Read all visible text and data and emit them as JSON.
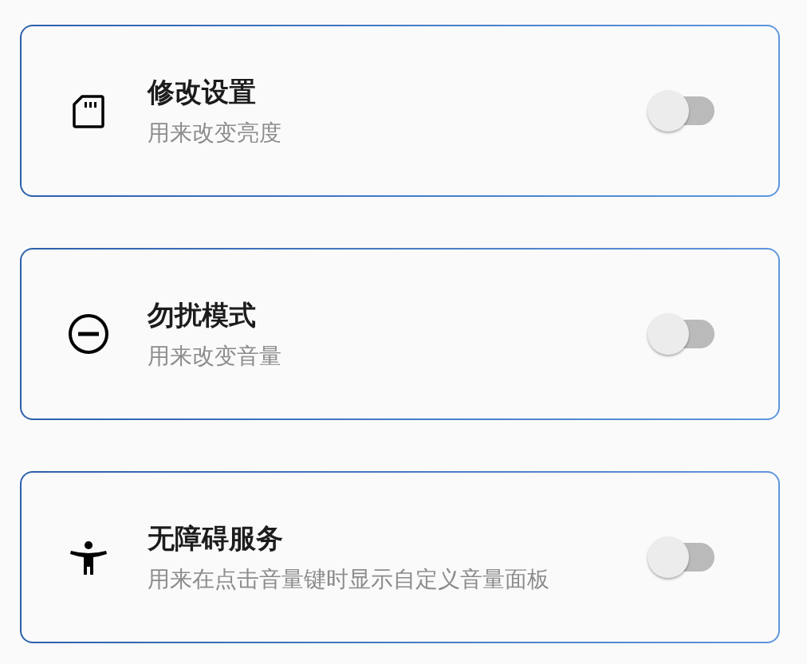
{
  "settings": [
    {
      "kind": "sd-card",
      "title": "修改设置",
      "subtitle": "用来改变亮度",
      "on": false
    },
    {
      "kind": "do-not-disturb",
      "title": "勿扰模式",
      "subtitle": "用来改变音量",
      "on": false
    },
    {
      "kind": "accessibility",
      "title": "无障碍服务",
      "subtitle": "用来在点击音量键时显示自定义音量面板",
      "on": false
    }
  ]
}
